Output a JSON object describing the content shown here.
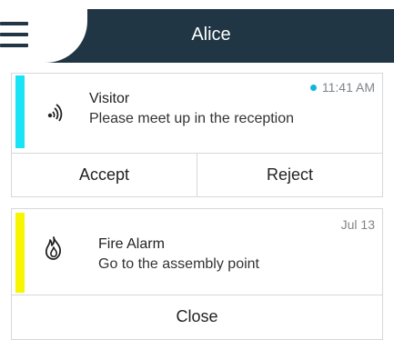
{
  "header": {
    "title": "Alice"
  },
  "notifications": [
    {
      "accent_color": "#18e4f5",
      "icon": "wireless-signal-icon",
      "title": "Visitor",
      "message": "Please meet up in the reception",
      "time": "11:41 AM",
      "unread_dot_color": "#16b3d9",
      "actions": [
        "Accept",
        "Reject"
      ]
    },
    {
      "accent_color": "#f8f500",
      "icon": "fire-icon",
      "title": "Fire Alarm",
      "message": "Go to the assembly point",
      "time": "Jul 13",
      "actions": [
        "Close"
      ]
    }
  ]
}
